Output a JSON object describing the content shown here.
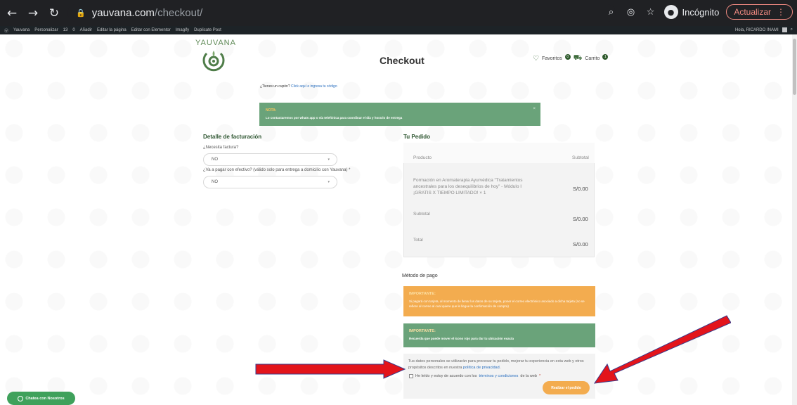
{
  "browser": {
    "url_domain": "yauvana.com",
    "url_path": "/checkout/",
    "incognito_label": "Incógnito",
    "update_label": "Actualizar"
  },
  "wpbar": {
    "items": [
      "Yauvana",
      "Personalizar",
      "13",
      "0",
      "Añadir",
      "Editar la página",
      "Editar con Elementor",
      "Imagify",
      "Duplicate Post"
    ],
    "greeting": "Hola, RICARDO INAMI"
  },
  "header": {
    "logo_text": "YAUVANA",
    "page_title": "Checkout",
    "favorites_label": "Favoritos",
    "favorites_count": "0",
    "cart_label": "Carrito",
    "cart_count": "1"
  },
  "coupon": {
    "question": "¿Tienes un cupón?",
    "link": "Click aquí e ingresa tu código"
  },
  "nota": {
    "title": "NOTA:",
    "text": "Lo contactaremos por whats app o vía telefónica para coordinar el día y horario de entrega",
    "close": "×"
  },
  "billing": {
    "heading": "Detalle de facturación",
    "invoice_label": "¿Necesita factura?",
    "invoice_value": "NO",
    "cash_label": "¿Va a pagar con efectivo? (válido solo para entrega a domicilio con Yauvana) *",
    "cash_value": "NO"
  },
  "order": {
    "heading": "Tu Pedido",
    "col_product": "Producto",
    "col_subtotal": "Subtotal",
    "product_name": "Formación en Aromaterapia Ayurvédica \"Tratamientos ancestrales para los desequilibrios de hoy\" - Módulo I ¡GRATIS X TIEMPO LIMITADO!  × 1",
    "product_price": "S/0.00",
    "subtotal_label": "Subtotal",
    "subtotal_value": "S/0.00",
    "total_label": "Total",
    "total_value": "S/0.00"
  },
  "payment": {
    "heading": "Método de pago",
    "imp1_title": "IMPORTANTE:",
    "imp1_text": "Si pagará con tarjeta, al momento de llenar los datos de su tarjeta, poner el correo electrónico asociado a dicha tarjeta (no se refiere al correo al cual quiere que le llegue la confirmación de compra)",
    "imp2_title": "IMPORTANTE:",
    "imp2_text": "Recuerda que puede mover el ícono rojo para dar tu ubicación exacta",
    "privacy_text": "Tus datos personales se utilizarán para procesar tu pedido, mejorar tu experiencia en esta web y otros propósitos descritos en nuestra",
    "privacy_link": "política de privacidad",
    "terms_text": "He leído y estoy de acuerdo con los",
    "terms_link": "términos y condiciones",
    "terms_suffix": "de la web",
    "required_mark": "*",
    "place_order": "Realizar el pedido"
  },
  "chat": {
    "label": "Chatea con Nosotros"
  },
  "colors": {
    "green": "#6aa37a",
    "orange": "#f3ac4f",
    "arrow_red": "#e3141b"
  }
}
